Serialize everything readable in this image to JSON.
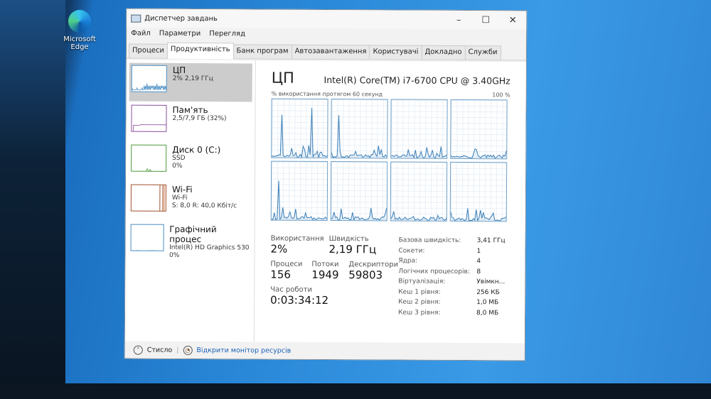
{
  "desktop": {
    "icon_label": "Microsoft Edge"
  },
  "window": {
    "title": "Диспетчер завдань",
    "min": "–",
    "max": "☐",
    "close": "✕"
  },
  "menu": [
    "Файл",
    "Параметри",
    "Перегляд"
  ],
  "tabs": [
    "Процеси",
    "Продуктивність",
    "Банк програм",
    "Автозавантаження",
    "Користувачі",
    "Докладно",
    "Служби"
  ],
  "resources": [
    {
      "name": "ЦП",
      "sub1": "2%  2,19 ГГц",
      "sub2": "",
      "sub3": "",
      "color": "#4a8dc2"
    },
    {
      "name": "Пам'ять",
      "sub1": "2,5/7,9 ГБ (32%)",
      "sub2": "",
      "sub3": "",
      "color": "#8b4f9e"
    },
    {
      "name": "Диск 0 (C:)",
      "sub1": "SSD",
      "sub2": "0%",
      "sub3": "",
      "color": "#4d9a3a"
    },
    {
      "name": "Wi-Fi",
      "sub1": "Wi-Fi",
      "sub2": "S: 8,0  R: 40,0 Кбіт/с",
      "sub3": "",
      "color": "#a0522d"
    },
    {
      "name": "Графічний процес",
      "sub1": "Intel(R) HD Graphics 530",
      "sub2": "0%",
      "sub3": "",
      "color": "#4a8dc2"
    }
  ],
  "cpu": {
    "title": "ЦП",
    "model": "Intel(R) Core(TM) i7-6700 CPU @ 3.40GHz",
    "graph_label": "% використання протягом 60 секунд",
    "graph_max": "100 %",
    "usage_label": "Використання",
    "usage": "2%",
    "speed_label": "Швидкість",
    "speed": "2,19 ГГц",
    "proc_label": "Процеси",
    "proc": "156",
    "threads_label": "Потоки",
    "threads": "1949",
    "handles_label": "Дескриптори",
    "handles": "59803",
    "uptime_label": "Час роботи",
    "uptime": "0:03:34:12",
    "details": [
      [
        "Базова швидкість:",
        "3,41 ГГц"
      ],
      [
        "Сокети:",
        "1"
      ],
      [
        "Ядра:",
        "4"
      ],
      [
        "Логічних процесорів:",
        "8"
      ],
      [
        "Віртуалізація:",
        "Увімкн..."
      ],
      [
        "Кеш 1 рівня:",
        "256 КБ"
      ],
      [
        "Кеш 2 рівня:",
        "1,0 МБ"
      ],
      [
        "Кеш 3 рівня:",
        "8,0 МБ"
      ]
    ]
  },
  "footer": {
    "less": "Стисло",
    "monitor": "Відкрити монітор ресурсів"
  }
}
